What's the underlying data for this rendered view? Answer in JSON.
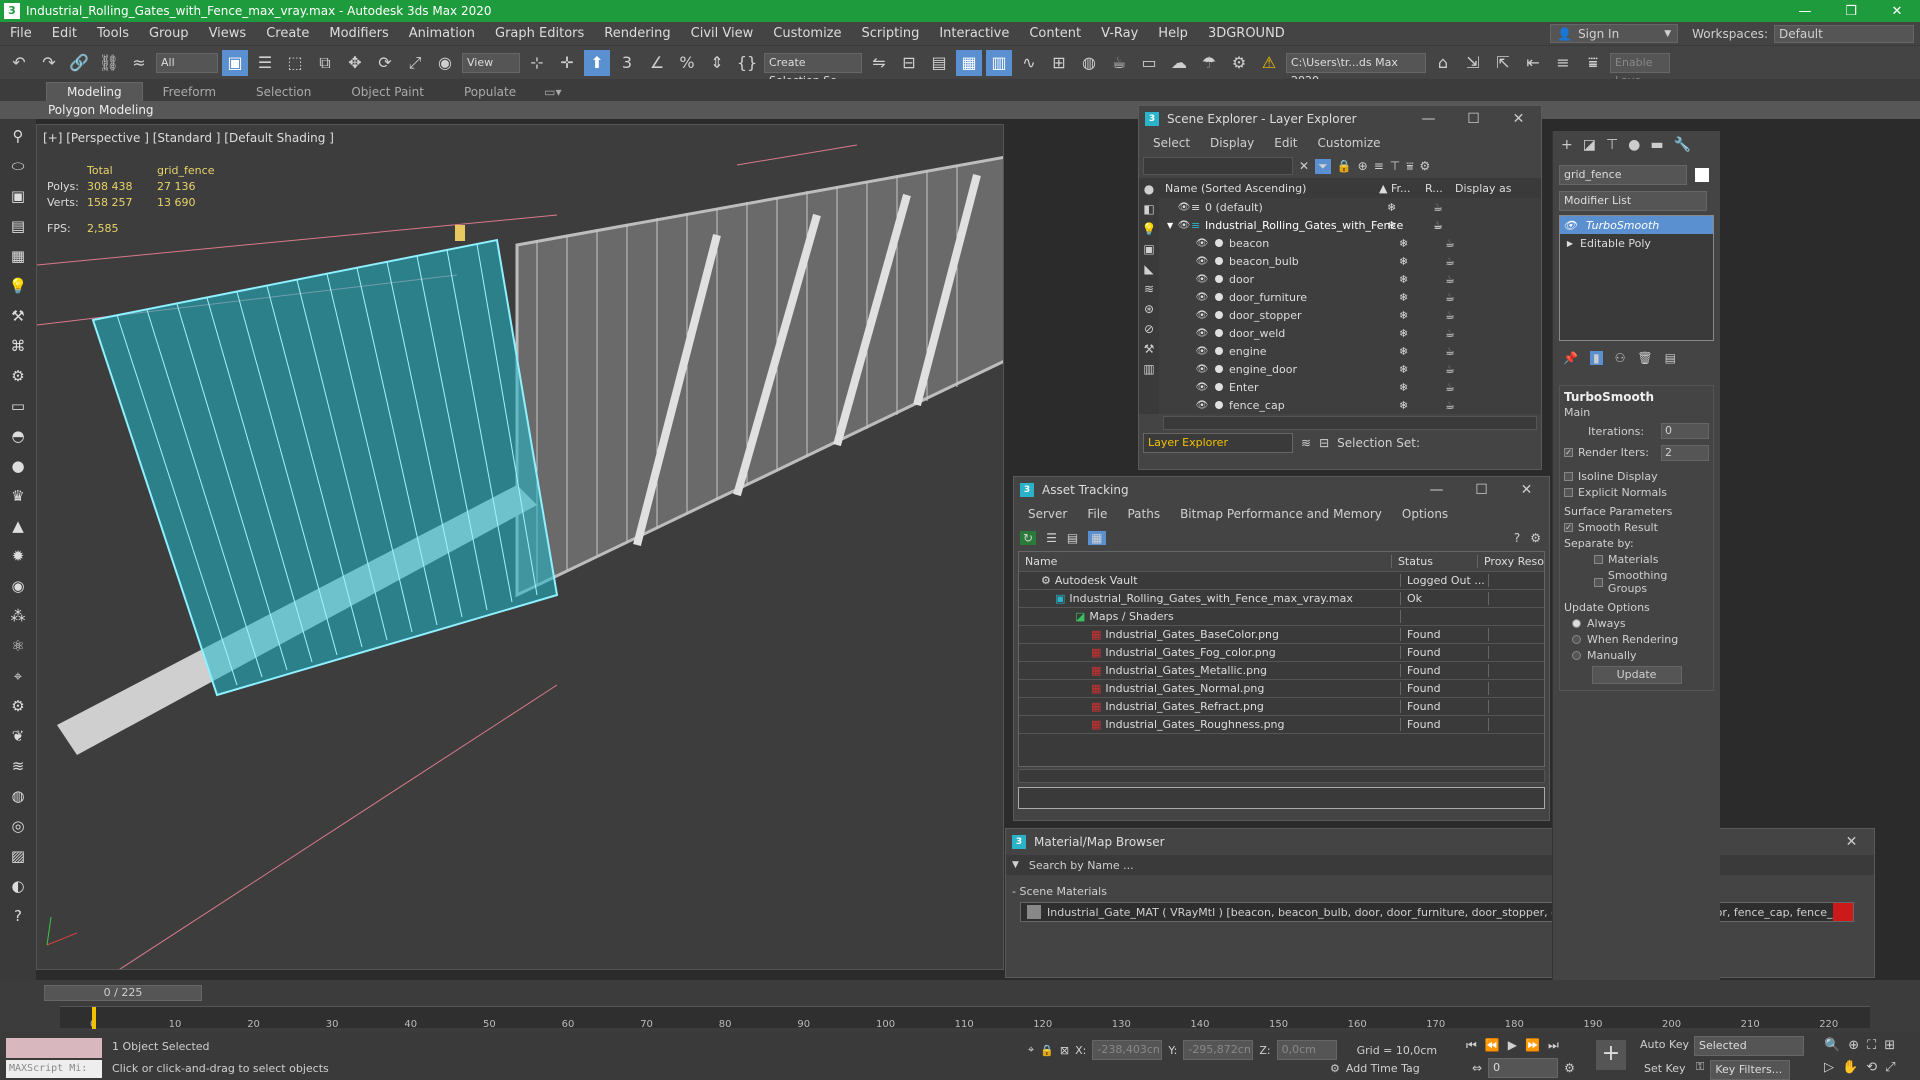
{
  "window": {
    "app_icon": "3",
    "title": "Industrial_Rolling_Gates_with_Fence_max_vray.max - Autodesk 3ds Max 2020",
    "min": "—",
    "max": "❐",
    "close": "✕"
  },
  "menubar": {
    "items": [
      "File",
      "Edit",
      "Tools",
      "Group",
      "Views",
      "Create",
      "Modifiers",
      "Animation",
      "Graph Editors",
      "Rendering",
      "Civil View",
      "Customize",
      "Scripting",
      "Interactive",
      "Content",
      "V-Ray",
      "Help",
      "3DGROUND"
    ],
    "signin": "Sign In",
    "workspaces_label": "Workspaces:",
    "workspaces_value": "Default"
  },
  "toolbar": {
    "filter_value": "All",
    "view_value": "View",
    "selection_set_placeholder": "Create Selection Se",
    "path_value": "C:\\Users\\tr...ds Max 2020",
    "enable_layer": "Enable Laye"
  },
  "ribbon": {
    "tabs": [
      "Modeling",
      "Freeform",
      "Selection",
      "Object Paint",
      "Populate"
    ],
    "sub": "Polygon Modeling"
  },
  "viewport": {
    "label": "[+] [Perspective ] [Standard ] [Default Shading ]",
    "stats": {
      "header_total": "Total",
      "header_obj": "grid_fence",
      "polys_label": "Polys:",
      "polys_total": "308 438",
      "polys_obj": "27 136",
      "verts_label": "Verts:",
      "verts_total": "158 257",
      "verts_obj": "13 690",
      "fps_label": "FPS:",
      "fps_value": "2,585"
    }
  },
  "scene_explorer": {
    "title": "Scene Explorer - Layer Explorer",
    "menu": [
      "Select",
      "Display",
      "Edit",
      "Customize"
    ],
    "col_name": "Name (Sorted Ascending)",
    "col_fr": "▲ Fr...",
    "col_r": "R...",
    "col_disp": "Display as",
    "rows": [
      {
        "name": "0 (default)",
        "indent": 0
      },
      {
        "name": "Industrial_Rolling_Gates_with_Fence",
        "indent": 1
      },
      {
        "name": "beacon",
        "indent": 2
      },
      {
        "name": "beacon_bulb",
        "indent": 2
      },
      {
        "name": "door",
        "indent": 2
      },
      {
        "name": "door_furniture",
        "indent": 2
      },
      {
        "name": "door_stopper",
        "indent": 2
      },
      {
        "name": "door_weld",
        "indent": 2
      },
      {
        "name": "engine",
        "indent": 2
      },
      {
        "name": "engine_door",
        "indent": 2
      },
      {
        "name": "Enter",
        "indent": 2
      },
      {
        "name": "fence_cap",
        "indent": 2
      }
    ],
    "footer_label": "Layer Explorer",
    "selection_set": "Selection Set:"
  },
  "asset_tracking": {
    "title": "Asset Tracking",
    "menu": [
      "Server",
      "File",
      "Paths",
      "Bitmap Performance and Memory",
      "Options"
    ],
    "col_name": "Name",
    "col_status": "Status",
    "col_proxy": "Proxy Reso",
    "rows": [
      {
        "name": "Autodesk Vault",
        "status": "Logged Out ...",
        "indent": 1
      },
      {
        "name": "Industrial_Rolling_Gates_with_Fence_max_vray.max",
        "status": "Ok",
        "indent": 2
      },
      {
        "name": "Maps / Shaders",
        "status": "",
        "indent": 3
      },
      {
        "name": "Industrial_Gates_BaseColor.png",
        "status": "Found",
        "indent": 4
      },
      {
        "name": "Industrial_Gates_Fog_color.png",
        "status": "Found",
        "indent": 4
      },
      {
        "name": "Industrial_Gates_Metallic.png",
        "status": "Found",
        "indent": 4
      },
      {
        "name": "Industrial_Gates_Normal.png",
        "status": "Found",
        "indent": 4
      },
      {
        "name": "Industrial_Gates_Refract.png",
        "status": "Found",
        "indent": 4
      },
      {
        "name": "Industrial_Gates_Roughness.png",
        "status": "Found",
        "indent": 4
      }
    ]
  },
  "material_browser": {
    "title": "Material/Map Browser",
    "search_placeholder": "Search by Name ...",
    "section": "Scene Materials",
    "item": "Industrial_Gate_MAT ( VRayMtl ) [beacon, beacon_bulb, door, door_furniture, door_stopper, door_weld, engine, engine_door, fence_cap, fence_weld, gate,..."
  },
  "command_panel": {
    "object_name": "grid_fence",
    "modifier_list": "Modifier List",
    "stack": [
      "TurboSmooth",
      "Editable Poly"
    ],
    "rollout_title": "TurboSmooth",
    "main_label": "Main",
    "iterations_label": "Iterations:",
    "iterations_value": "0",
    "render_iters_label": "Render Iters:",
    "render_iters_value": "2",
    "isoline": "Isoline Display",
    "explicit_normals": "Explicit Normals",
    "surface_params": "Surface Parameters",
    "smooth_result": "Smooth Result",
    "separate_by": "Separate by:",
    "materials": "Materials",
    "smoothing_groups": "Smoothing Groups",
    "update_options": "Update Options",
    "always": "Always",
    "when_rendering": "When Rendering",
    "manually": "Manually",
    "update_button": "Update"
  },
  "timeline": {
    "frame": "0 / 225",
    "ticks": [
      "0",
      "10",
      "20",
      "30",
      "40",
      "50",
      "60",
      "70",
      "80",
      "90",
      "100",
      "110",
      "120",
      "130",
      "140",
      "150",
      "160",
      "170",
      "180",
      "190",
      "200",
      "210",
      "220"
    ]
  },
  "statusbar": {
    "maxscript": "MAXScript Mi:",
    "selected": "1 Object Selected",
    "prompt": "Click or click-and-drag to select objects",
    "x_label": "X:",
    "x_value": "-238,403cn",
    "y_label": "Y:",
    "y_value": "-295,872cn",
    "z_label": "Z:",
    "z_value": "0,0cm",
    "grid": "Grid = 10,0cm",
    "add_time_tag": "Add Time Tag",
    "auto_key": "Auto Key",
    "set_key": "Set Key",
    "selected_dd": "Selected",
    "key_filters": "Key Filters...",
    "frame_value": "0"
  }
}
